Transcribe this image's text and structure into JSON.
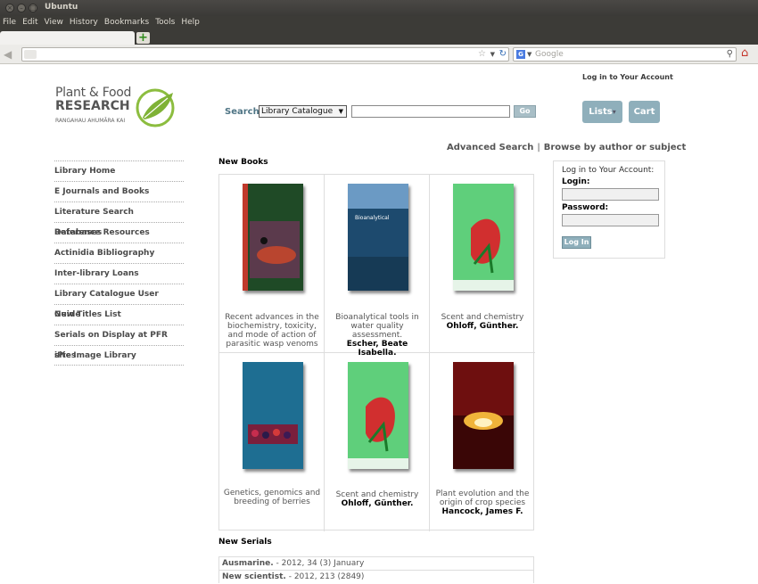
{
  "window": {
    "title": "Ubuntu",
    "controls": [
      "×",
      "–",
      "□"
    ]
  },
  "menu": [
    "File",
    "Edit",
    "View",
    "History",
    "Bookmarks",
    "Tools",
    "Help"
  ],
  "browser": {
    "newtab_symbol": "+",
    "url": "",
    "search_engine_icon": "G",
    "search_placeholder": "Google"
  },
  "header": {
    "account_link": "Log in to Your Account",
    "logo": {
      "line1": "Plant & Food",
      "line2": "RESEARCH",
      "tagline": "RANGAHAU AHUMĀRA KAI"
    }
  },
  "search": {
    "label": "Search",
    "scope": "Library Catalogue",
    "query": "",
    "go_label": "Go"
  },
  "buttons": {
    "lists": "Lists",
    "lists_arrow": "▾",
    "cart": "Cart"
  },
  "links": {
    "advanced": "Advanced Search",
    "separator": "|",
    "browse": "Browse by author or subject"
  },
  "sidebar": {
    "items": [
      {
        "label": "Library Home"
      },
      {
        "label": "E Journals and Books"
      },
      {
        "label": "Literature Search Databases"
      },
      {
        "label": "Reference Resources"
      },
      {
        "label": "Actinidia Bibliography"
      },
      {
        "label": "Inter-library Loans"
      },
      {
        "label": "Library Catalogue User Guide"
      },
      {
        "label": "New Titles List"
      },
      {
        "label": "Serials on Display at PFR sites"
      },
      {
        "label": "iPic Image Library"
      }
    ]
  },
  "new_books": {
    "heading": "New Books",
    "books": [
      {
        "title": "Recent advances in the biochemistry, toxicity, and mode of action of parasitic wasp venoms",
        "author": "",
        "cover_color": "#2f5e2c"
      },
      {
        "title": "Bioanalytical tools in water quality assessment.",
        "author": "Escher, Beate Isabella.",
        "cover_color": "#1d4a6e"
      },
      {
        "title": "Scent and chemistry",
        "author": "Ohloff, Günther.",
        "cover_color": "#56c470"
      },
      {
        "title": "Genetics, genomics and breeding of berries",
        "author": "",
        "cover_color": "#1f6a8c"
      },
      {
        "title": "Scent and chemistry",
        "author": "Ohloff, Günther.",
        "cover_color": "#56c470"
      },
      {
        "title": "Plant evolution and the origin of crop species",
        "author": "Hancock, James F.",
        "cover_color": "#7a1414"
      }
    ]
  },
  "login": {
    "heading": "Log in to Your Account:",
    "login_label": "Login:",
    "password_label": "Password:",
    "button": "Log In"
  },
  "new_serials": {
    "heading": "New Serials",
    "items": [
      {
        "name": "Ausmarine.",
        "detail": " - 2012, 34 (3) January"
      },
      {
        "name": "New scientist.",
        "detail": " - 2012, 213 (2849)"
      }
    ]
  }
}
